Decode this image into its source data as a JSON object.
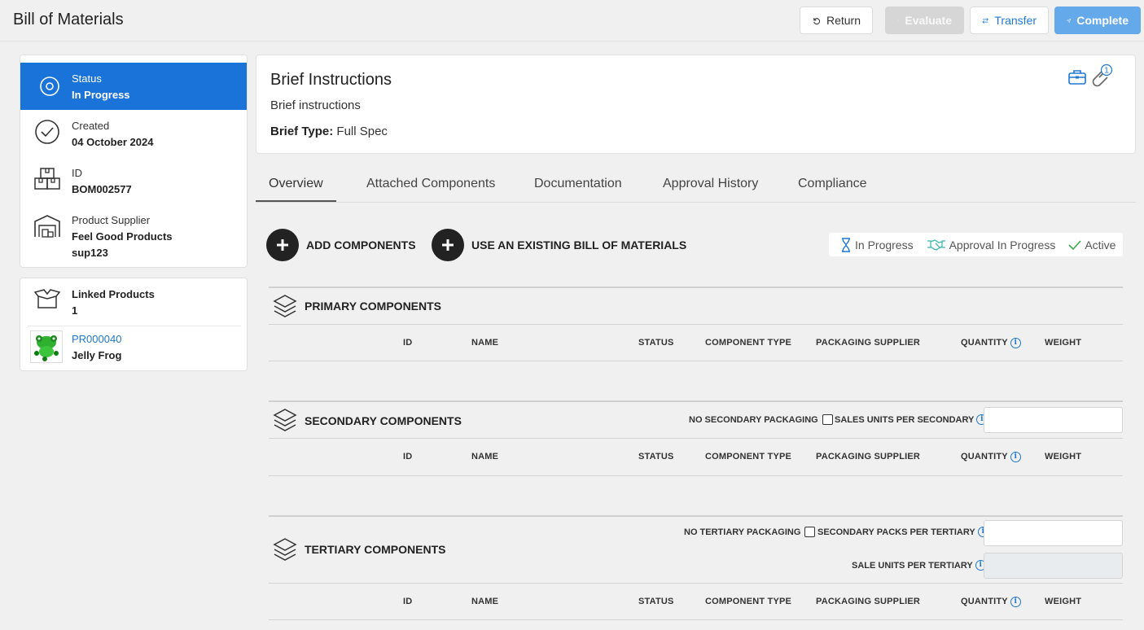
{
  "header": {
    "title": "Bill of Materials",
    "buttons": {
      "return": "Return",
      "evaluate": "Evaluate",
      "transfer": "Transfer",
      "complete": "Complete"
    }
  },
  "sidebar": {
    "status": {
      "label": "Status",
      "value": "In Progress"
    },
    "created": {
      "label": "Created",
      "value": "04 October 2024"
    },
    "id": {
      "label": "ID",
      "value": "BOM002577"
    },
    "supplier": {
      "label": "Product Supplier",
      "value": "Feel Good Products",
      "code": "sup123"
    },
    "linked": {
      "label": "Linked Products",
      "count": "1",
      "product_id": "PR000040",
      "product_name": "Jelly Frog"
    }
  },
  "brief": {
    "title": "Brief Instructions",
    "text": "Brief instructions",
    "type_label": "Brief Type:",
    "type_value": "Full Spec",
    "attachment_count": "1"
  },
  "tabs": [
    "Overview",
    "Attached Components",
    "Documentation",
    "Approval History",
    "Compliance"
  ],
  "actions": {
    "add": "ADD COMPONENTS",
    "use_existing": "USE AN EXISTING BILL OF MATERIALS"
  },
  "legend": {
    "in_progress": "In Progress",
    "approval": "Approval In Progress",
    "active": "Active"
  },
  "columns": {
    "id": "ID",
    "name": "NAME",
    "status": "STATUS",
    "type": "COMPONENT TYPE",
    "supplier": "PACKAGING SUPPLIER",
    "quantity": "QUANTITY",
    "weight": "WEIGHT"
  },
  "sections": {
    "primary": {
      "title": "PRIMARY COMPONENTS"
    },
    "secondary": {
      "title": "SECONDARY COMPONENTS",
      "no_packaging": "NO SECONDARY PACKAGING",
      "units_label": "SALES UNITS PER SECONDARY",
      "units_value": ""
    },
    "tertiary": {
      "title": "TERTIARY COMPONENTS",
      "no_packaging": "NO TERTIARY PACKAGING",
      "packs_label": "SECONDARY PACKS PER TERTIARY",
      "packs_value": "",
      "units_label": "SALE UNITS PER TERTIARY",
      "units_value": ""
    }
  },
  "colors": {
    "accent": "#1a73d9",
    "complete": "#64aaea",
    "link": "#1e78d2",
    "approval": "#3fb8b0",
    "active": "#3aa84f"
  }
}
